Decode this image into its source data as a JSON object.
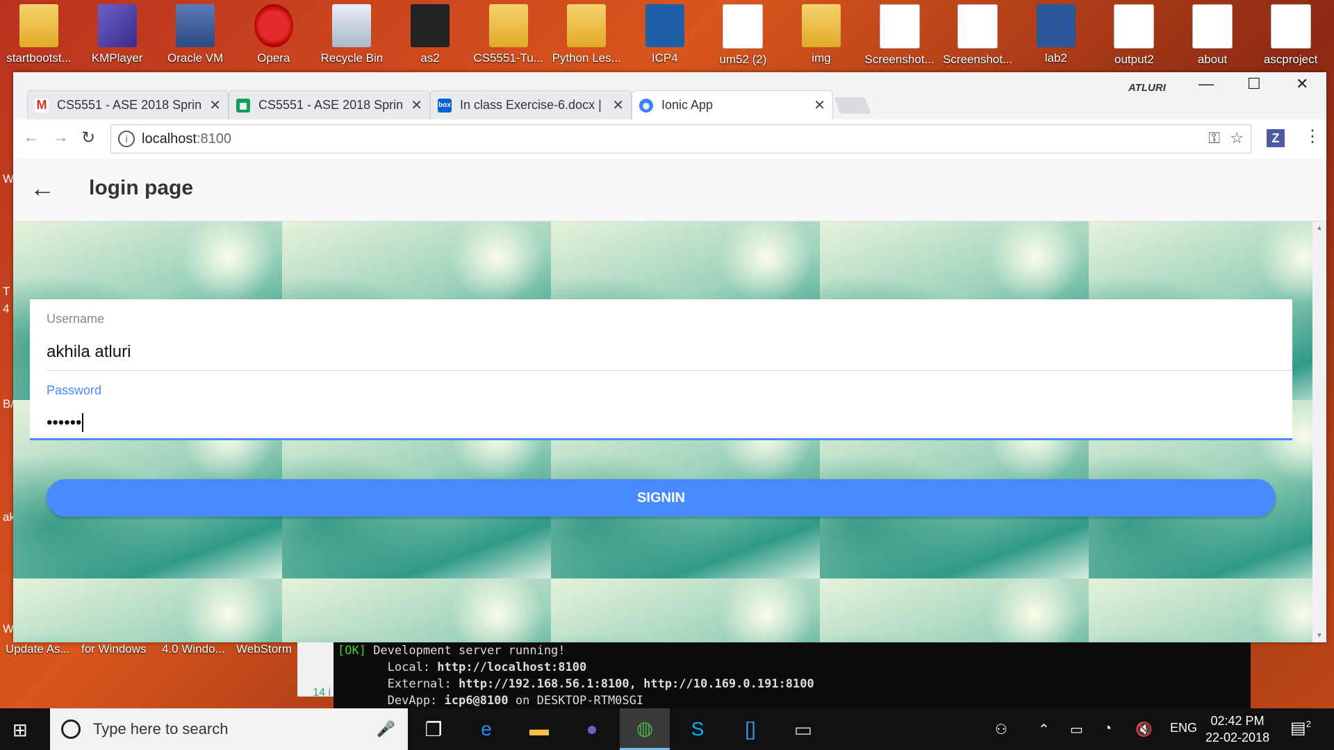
{
  "desktop": {
    "icons": [
      {
        "label": "startbootst...",
        "icon": "folder-icon"
      },
      {
        "label": "KMPlayer",
        "icon": "kmplayer-icon"
      },
      {
        "label": "Oracle VM",
        "icon": "virtualbox-icon"
      },
      {
        "label": "Opera",
        "icon": "opera-icon"
      },
      {
        "label": "Recycle Bin",
        "icon": "recycle-bin-icon"
      },
      {
        "label": "as2",
        "icon": "pycharm-icon"
      },
      {
        "label": "CS5551-Tu...",
        "icon": "folder-icon"
      },
      {
        "label": "Python Les...",
        "icon": "folder-icon"
      },
      {
        "label": "ICP4",
        "icon": "brackets-icon"
      },
      {
        "label": "um52 (2)",
        "icon": "pdf-icon"
      },
      {
        "label": "img",
        "icon": "folder-icon"
      },
      {
        "label": "Screenshot...",
        "icon": "image-icon"
      },
      {
        "label": "Screenshot...",
        "icon": "image-icon"
      },
      {
        "label": "lab2",
        "icon": "word-icon"
      },
      {
        "label": "output2",
        "icon": "image-icon"
      },
      {
        "label": "about",
        "icon": "file-icon"
      },
      {
        "label": "ascproject",
        "icon": "file-icon"
      }
    ],
    "bottom_labels": [
      "Update As...",
      "for Windows",
      "4.0 Windo...",
      "WebStorm"
    ],
    "left_edge_letters": [
      "W",
      "T",
      "4",
      "B/",
      "ak",
      "W"
    ]
  },
  "browser": {
    "user_label": "ATLURI",
    "tabs": [
      {
        "title": "CS5551 - ASE 2018 Sprin",
        "favicon": "gmail-icon",
        "active": false
      },
      {
        "title": "CS5551 - ASE 2018 Sprin",
        "favicon": "sheets-icon",
        "active": false
      },
      {
        "title": "In class Exercise-6.docx |",
        "favicon": "box-icon",
        "active": false
      },
      {
        "title": "Ionic App",
        "favicon": "ionic-icon",
        "active": true
      }
    ],
    "address": {
      "host": "localhost",
      "port": ":8100"
    },
    "extension_label": "Z"
  },
  "app": {
    "title": "login page",
    "form": {
      "username_label": "Username",
      "username_value": "akhila atluri",
      "password_label": "Password",
      "password_value": "••••••"
    },
    "signin_label": "SIGNIN",
    "colors": {
      "primary": "#488aff"
    }
  },
  "terminal": {
    "ok_tag": "[OK]",
    "line1": " Development server running!",
    "local_label": "       Local: ",
    "local_url": "http://localhost:8100",
    "external_label": "       External: ",
    "external_urls": "http://192.168.56.1:8100, http://10.169.0.191:8100",
    "devapp_label": "       DevApp: ",
    "devapp_value": "icp6@8100",
    "devapp_tail": " on DESKTOP-RTM0SGI"
  },
  "peek_text": "14 i",
  "taskbar": {
    "search_placeholder": "Type here to search",
    "language": "ENG",
    "time": "02:42 PM",
    "date": "22-02-2018",
    "notifications": "2"
  }
}
